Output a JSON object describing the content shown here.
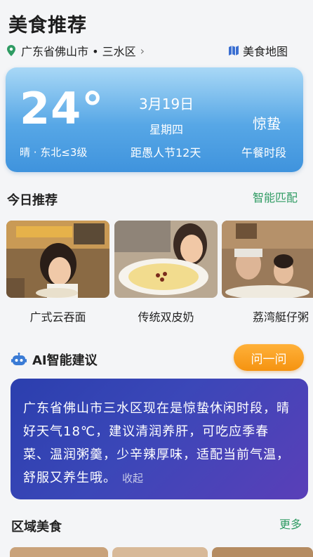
{
  "header": {
    "title": "美食推荐",
    "location": "广东省佛山市 • 三水区",
    "map_link": "美食地图"
  },
  "weather": {
    "temperature": "24°",
    "condition": "晴 · 东北≤3级",
    "date": "3月19日",
    "weekday": "星期四",
    "countdown": "距愚人节12天",
    "solar_term": "惊蛰",
    "meal_period": "午餐时段"
  },
  "today": {
    "title": "今日推荐",
    "action": "智能匹配",
    "items": [
      {
        "label": "广式云吞面"
      },
      {
        "label": "传统双皮奶"
      },
      {
        "label": "荔湾艇仔粥"
      }
    ]
  },
  "ai": {
    "title": "AI智能建议",
    "ask_button": "问一问",
    "suggestion": "广东省佛山市三水区现在是惊蛰休闲时段，晴好天气18℃，建议清润养肝，可吃应季春菜、温润粥羹，少辛辣厚味，适配当前气温，舒服又养生哦。",
    "collapse": "收起"
  },
  "region": {
    "title": "区域美食",
    "more": "更多"
  },
  "colors": {
    "accent_green": "#2f9b63",
    "ask_orange": "#f59310",
    "ai_card": "#3b47b8",
    "weather_blue": "#57a7e6"
  }
}
